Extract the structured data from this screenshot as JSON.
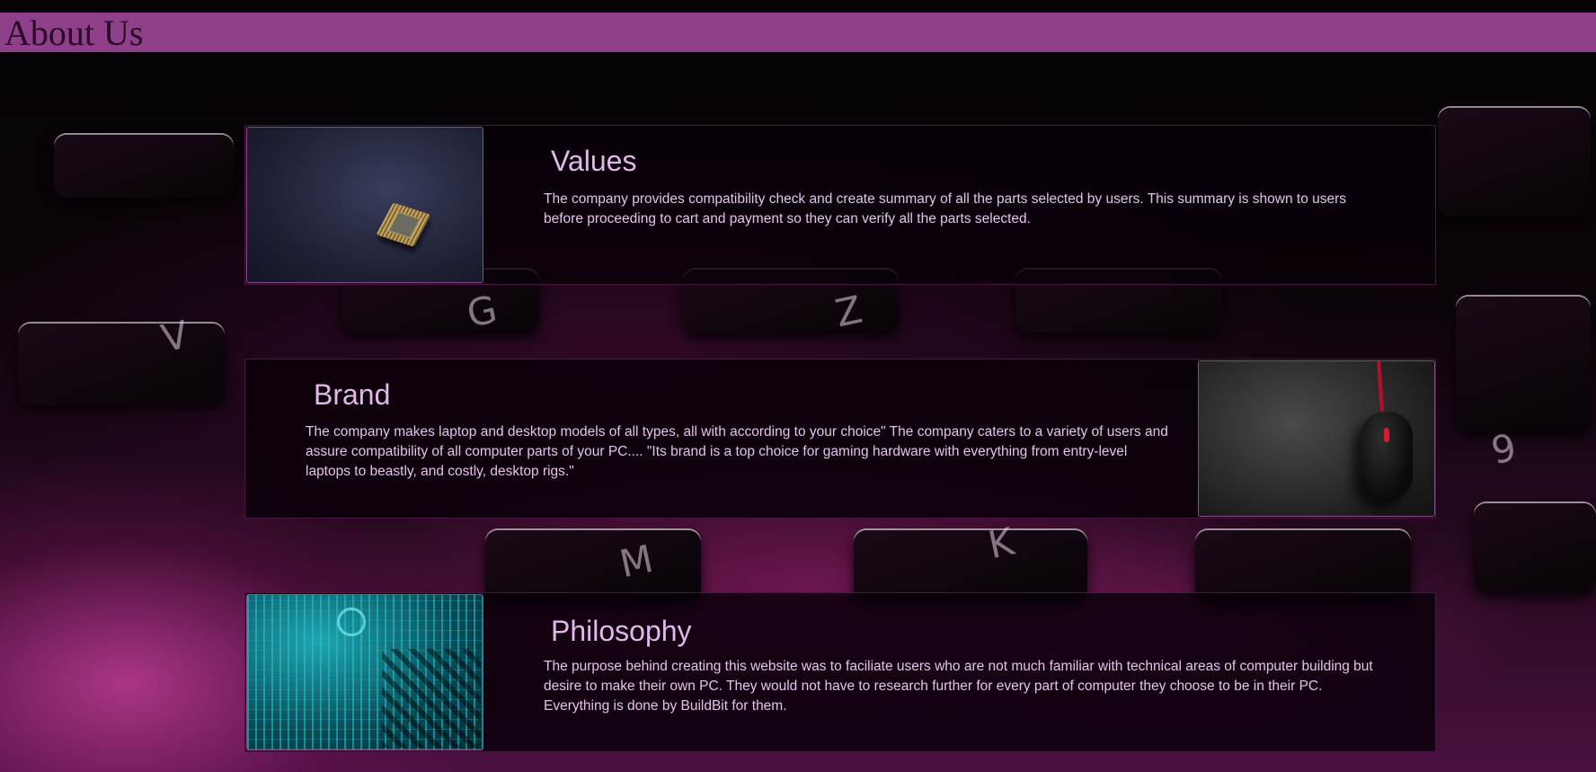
{
  "header": {
    "title": "About Us",
    "bg_color": "#8e418a"
  },
  "background": {
    "description_icon": "keyboard-background-image"
  },
  "sections": [
    {
      "title": "Values",
      "text": "The company provides compatibility check and create summary of all the parts selected by users. This summary is shown to users before proceeding to cart and payment so they can verify all the parts selected.",
      "image_icon": "cpu-chip-image"
    },
    {
      "title": "Brand",
      "text": "The company makes laptop and desktop models of all types, all with according to your choice\" The company caters to a variety of users and assure compatibility of all computer parts of your PC.... \"Its brand is a top choice for gaming hardware with everything from entry-level laptops to beastly, and costly, desktop rigs.\"",
      "image_icon": "computer-mouse-image"
    },
    {
      "title": "Philosophy",
      "text": "The purpose behind creating this website was to faciliate users who are not much familiar with technical areas of computer building but desire to make their own PC. They would not have to research further for every part of computer they choose to be in their PC. Everything is done by BuildBit for them.",
      "image_icon": "circuit-board-image"
    }
  ],
  "colors": {
    "title_text": "#e1b8ea",
    "body_text": "#e3c3ea",
    "card_border": "#4a1742"
  }
}
